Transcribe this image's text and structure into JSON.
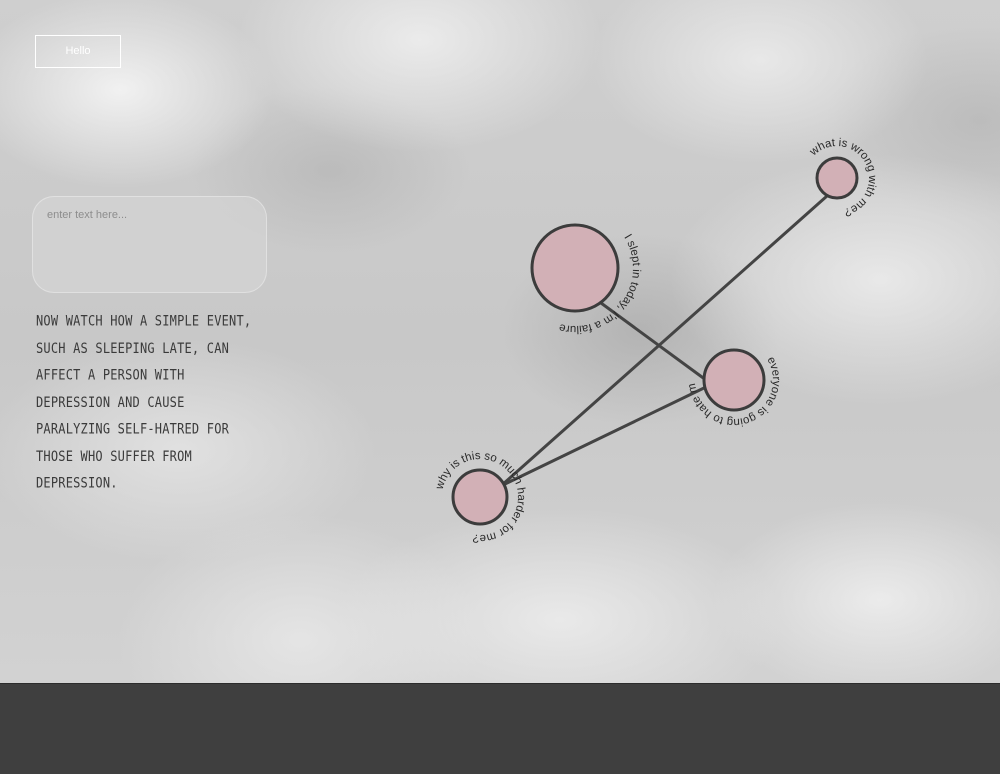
{
  "header": {
    "hello_label": "Hello"
  },
  "entry": {
    "placeholder": "enter text here...",
    "value": ""
  },
  "intro": {
    "text": "Now watch how a simple event, such as sleeping late, can affect a person with depression and cause paralyzing self-hatred for those who suffer from depression."
  },
  "graph": {
    "nodes": [
      {
        "id": "n1",
        "label": "I slept in today, I'm a failure"
      },
      {
        "id": "n2",
        "label": "what is wrong with me?"
      },
      {
        "id": "n3",
        "label": "everyone is going to hate me now."
      },
      {
        "id": "n4",
        "label": "why is this so much harder for me?"
      }
    ],
    "edges": [
      {
        "from": "n1",
        "to": "n3"
      },
      {
        "from": "n3",
        "to": "n4"
      },
      {
        "from": "n2",
        "to": "n4"
      }
    ]
  },
  "colors": {
    "node_fill": "#d2b0b6",
    "node_stroke": "#3c3c3c",
    "edge": "#444444",
    "ground": "#3f3f3f"
  }
}
